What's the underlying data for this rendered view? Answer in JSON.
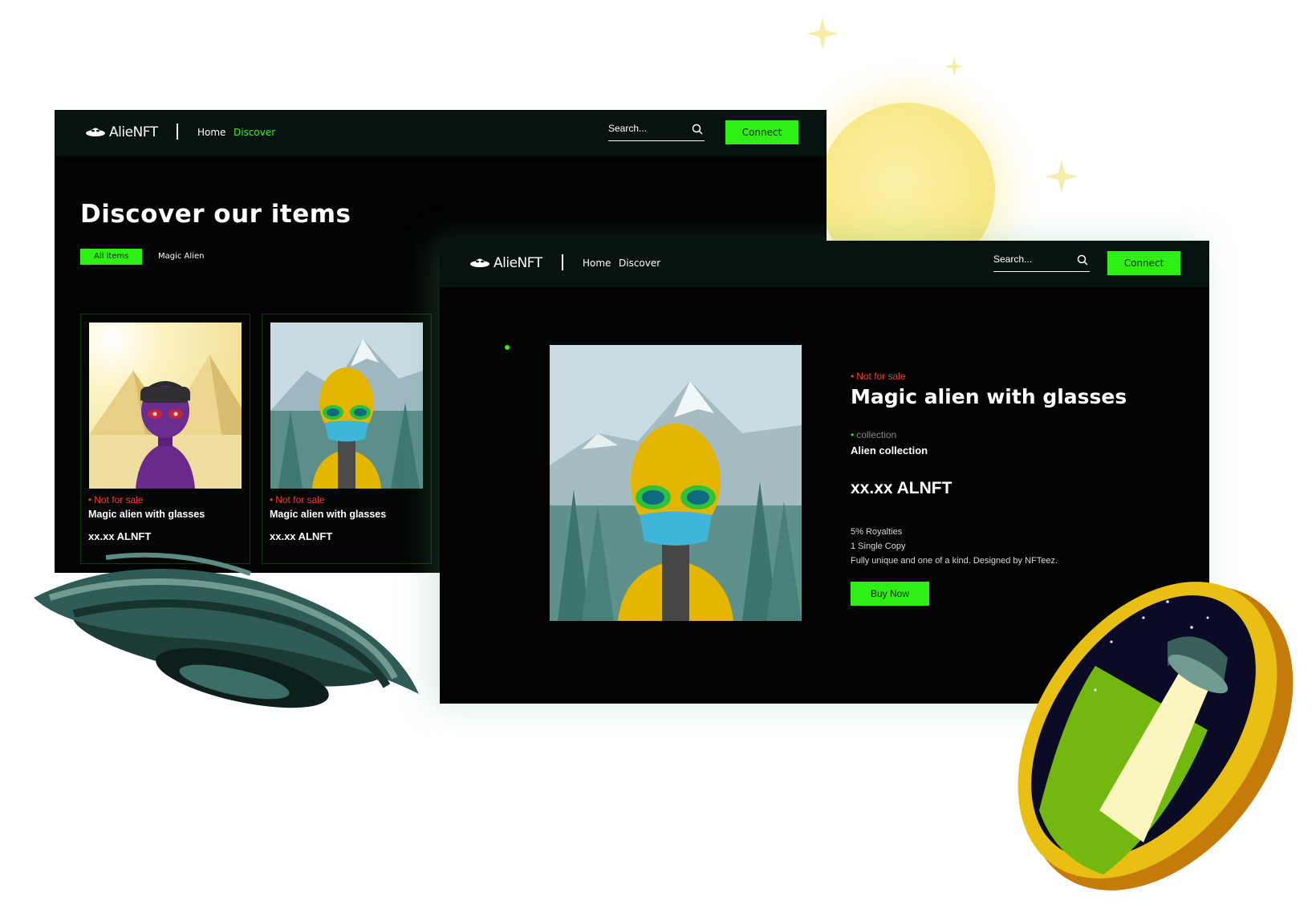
{
  "brand": {
    "name": "AlieNFT"
  },
  "nav": {
    "home": "Home",
    "discover": "Discover"
  },
  "search": {
    "placeholder": "Search..."
  },
  "connect_label": "Connect",
  "discover_page": {
    "title": "Discover our items",
    "filters": [
      "All items",
      "Magic Alien"
    ],
    "active_filter": "All items",
    "cards": [
      {
        "status": "Not for sale",
        "name": "Magic alien with glasses",
        "price": "xx.xx ALNFT",
        "art": "purple-alien-pyramids"
      },
      {
        "status": "Not for sale",
        "name": "Magic alien with glasses",
        "price": "xx.xx ALNFT",
        "art": "yellow-alien-mountains"
      }
    ]
  },
  "detail_page": {
    "status": "Not for sale",
    "title": "Magic alien with glasses",
    "collection_label": "collection",
    "collection_name": "Alien collection",
    "price": "xx.xx ALNFT",
    "features": [
      "5% Royalties",
      "1 Single Copy",
      "Fully unique and one of a kind. Designed by NFTeez."
    ],
    "buy_label": "Buy Now"
  },
  "colors": {
    "accent": "#2ff014",
    "status": "#ff3b30",
    "nav_bg": "#061310",
    "page_bg": "#020202"
  },
  "decorations": [
    "moon",
    "stars",
    "ufo",
    "gold-coin"
  ]
}
